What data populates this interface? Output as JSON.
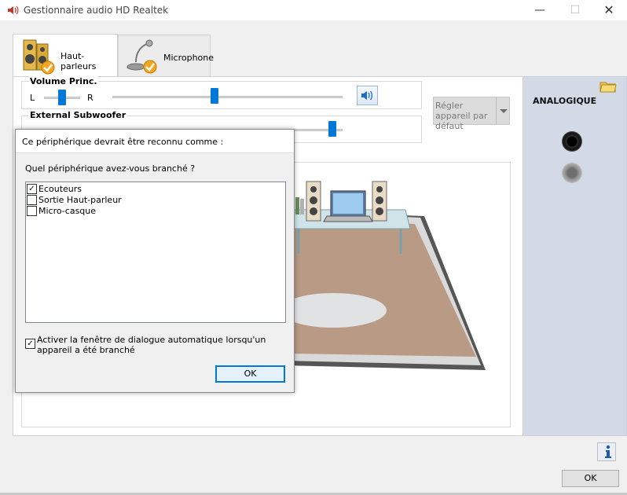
{
  "window": {
    "title": "Gestionnaire audio HD Realtek",
    "icon": "speaker-icon",
    "controls": {
      "minimize": "—",
      "maximize": "☐",
      "close": "✕"
    }
  },
  "tabs": [
    {
      "label": "Haut-parleurs",
      "icon": "speaker-pair-icon",
      "active": true
    },
    {
      "label": "Microphone",
      "icon": "microphone-icon",
      "active": false
    }
  ],
  "volume": {
    "title": "Volume Princ.",
    "left_label": "L",
    "right_label": "R",
    "balance": 0.5,
    "level": 0.44,
    "mute_icon": "speaker-volume-icon"
  },
  "subwoofer": {
    "title": "External Subwoofer",
    "level": 0.97
  },
  "default_device_button": {
    "label": "Régler appareil par défaut",
    "enabled": false
  },
  "analog": {
    "title": "ANALOGIQUE",
    "folder_icon": "folder-icon",
    "jacks": [
      {
        "name": "jack-black",
        "color": "#1a1a1a"
      },
      {
        "name": "jack-gray",
        "color": "#8a8a8a"
      }
    ]
  },
  "dialog": {
    "title": "Ce périphérique devrait être reconnu comme :",
    "question": "Quel périphérique avez-vous branché ?",
    "devices": [
      {
        "label": "Ecouteurs",
        "checked": true
      },
      {
        "label": "Sortie Haut-parleur",
        "checked": false
      },
      {
        "label": "Micro-casque",
        "checked": false
      }
    ],
    "auto_popup_label": "Activer la fenêtre de dialogue automatique lorsqu'un appareil a été branché",
    "auto_popup_checked": true,
    "ok_label": "OK"
  },
  "footer": {
    "info_icon": "info-icon",
    "ok_label": "OK"
  },
  "colors": {
    "accent": "#0078d7",
    "right_panel": "#d3dae5",
    "rug": "#b99a85"
  }
}
